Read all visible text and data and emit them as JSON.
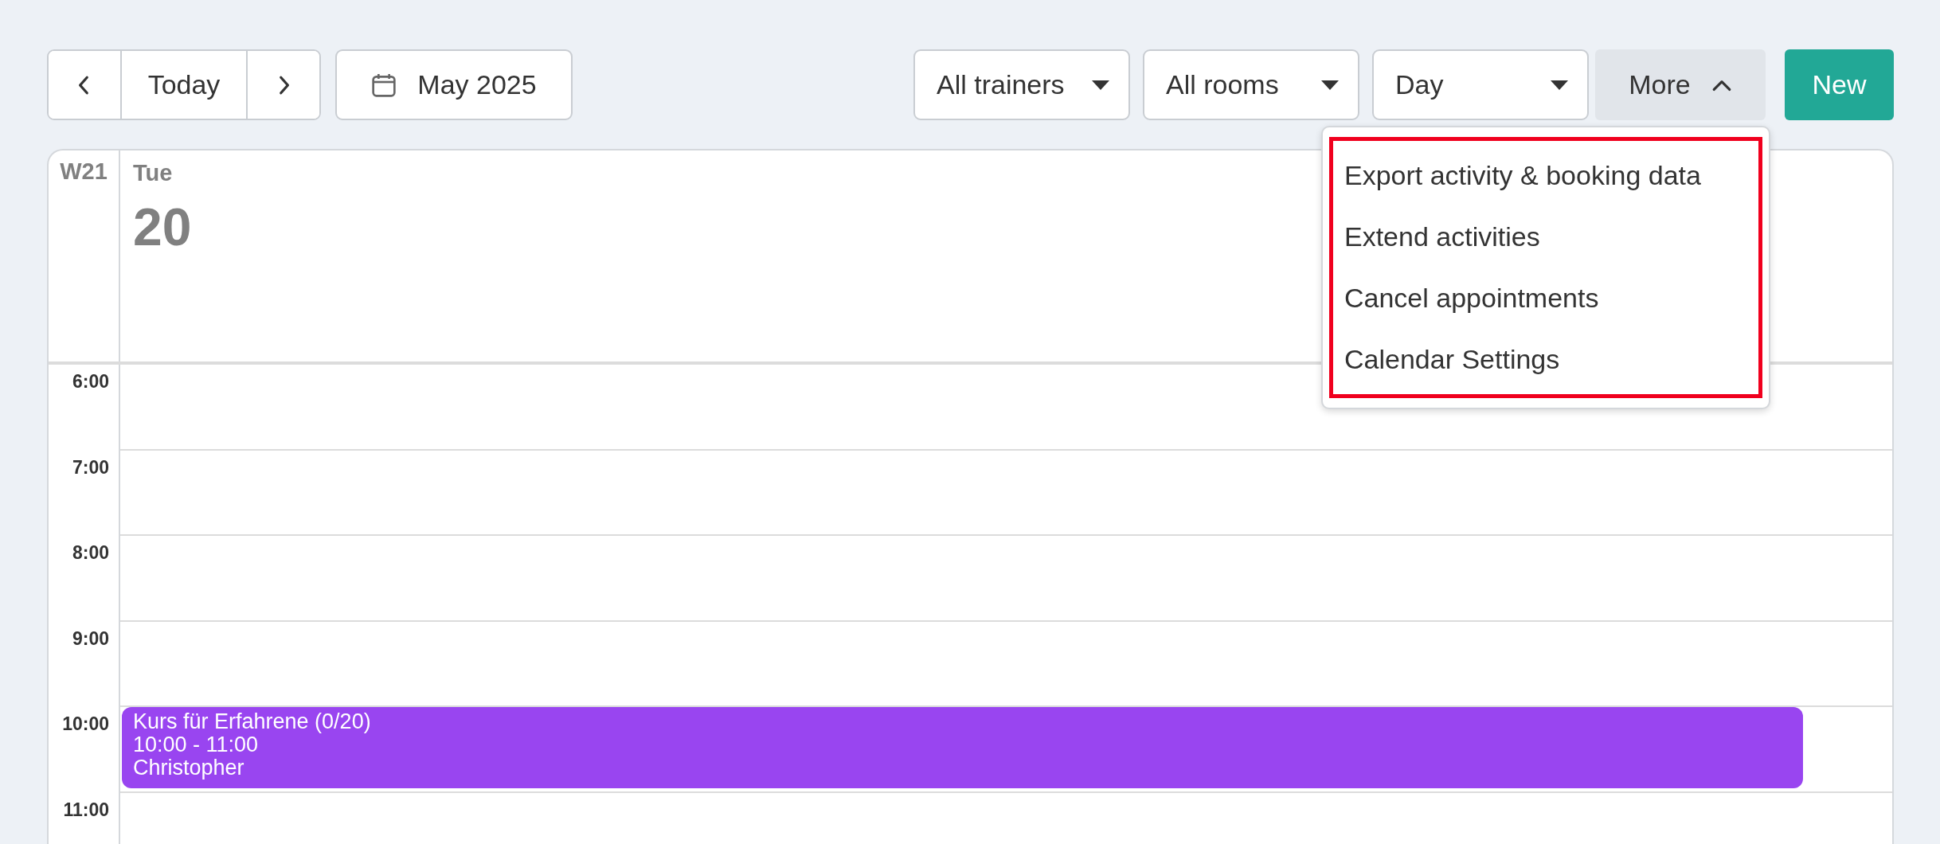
{
  "toolbar": {
    "today": "Today",
    "month": "May 2025",
    "filters": [
      {
        "label": "All trainers"
      },
      {
        "label": "All rooms"
      },
      {
        "label": "Day"
      }
    ],
    "more": {
      "label": "More",
      "expanded": true
    },
    "new_button": "New"
  },
  "more_menu": {
    "items": [
      {
        "label": "Export activity & booking data"
      },
      {
        "label": "Extend activities"
      },
      {
        "label": "Cancel appointments"
      },
      {
        "label": "Calendar Settings"
      }
    ]
  },
  "calendar": {
    "week": "W21",
    "day_name": "Tue",
    "day_number": "20",
    "hours": [
      {
        "label": "6:00"
      },
      {
        "label": "7:00"
      },
      {
        "label": "8:00"
      },
      {
        "label": "9:00"
      },
      {
        "label": "10:00",
        "events": [
          {
            "title": "Kurs für Erfahrene (0/20)",
            "time": "10:00 - 11:00",
            "trainer": "Christopher",
            "color": "#9945f0"
          }
        ]
      },
      {
        "label": "11:00"
      }
    ]
  }
}
